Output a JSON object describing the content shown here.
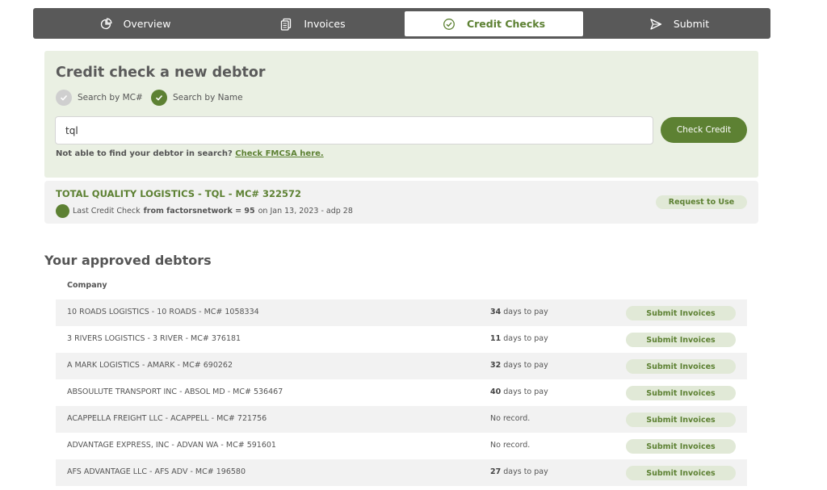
{
  "nav": {
    "tabs": [
      {
        "label": "Overview",
        "icon": "pie-chart-icon"
      },
      {
        "label": "Invoices",
        "icon": "documents-icon"
      },
      {
        "label": "Credit Checks",
        "icon": "check-circle-icon",
        "active": true
      },
      {
        "label": "Submit",
        "icon": "send-icon"
      }
    ]
  },
  "credit_check": {
    "title": "Credit check a new debtor",
    "options": [
      {
        "label": "Search by MC#",
        "selected": false
      },
      {
        "label": "Search by Name",
        "selected": true
      }
    ],
    "search_value": "tql",
    "button_label": "Check Credit",
    "hint_text": "Not able to find your debtor in search?",
    "hint_link": "Check FMCSA here."
  },
  "result": {
    "title": "TOTAL QUALITY LOGISTICS - TQL - MC# 322572",
    "sub_prefix": "Last Credit Check",
    "sub_bold": "from factorsnetwork = 95",
    "sub_suffix": "on Jan 13, 2023 - adp 28",
    "button_label": "Request to Use"
  },
  "approved": {
    "title": "Your approved debtors",
    "column_company": "Company",
    "button_label": "Submit Invoices",
    "days_suffix": "days to pay",
    "rows": [
      {
        "company": "10 ROADS LOGISTICS - 10 ROADS - MC# 1058334",
        "days": "34",
        "status": ""
      },
      {
        "company": "3 RIVERS LOGISTICS - 3 RIVER - MC# 376181",
        "days": "11",
        "status": ""
      },
      {
        "company": "A MARK LOGISTICS - AMARK - MC# 690262",
        "days": "32",
        "status": ""
      },
      {
        "company": "ABSOULUTE TRANSPORT INC - ABSOL MD - MC# 536467",
        "days": "40",
        "status": ""
      },
      {
        "company": "ACAPPELLA FREIGHT LLC - ACAPPELL - MC# 721756",
        "days": "",
        "status": "No record."
      },
      {
        "company": "ADVANTAGE EXPRESS, INC - ADVAN WA - MC# 591601",
        "days": "",
        "status": "No record."
      },
      {
        "company": "AFS ADVANTAGE LLC - AFS ADV - MC# 196580",
        "days": "27",
        "status": ""
      }
    ]
  },
  "colors": {
    "accent": "#5d8133",
    "nav_bg": "#595959",
    "panel_bg": "#eaf0e3"
  }
}
